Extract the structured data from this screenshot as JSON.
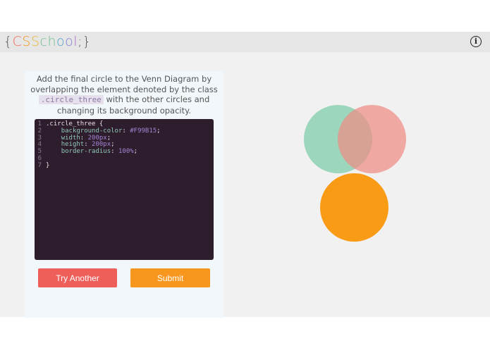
{
  "logo": {
    "parts": [
      {
        "text": "{",
        "color": "#555555"
      },
      {
        "text": "C",
        "color": "#f26b5b"
      },
      {
        "text": "S",
        "color": "#f7971e"
      },
      {
        "text": "S",
        "color": "#e8b838"
      },
      {
        "text": "ch",
        "color": "#6fbf8f"
      },
      {
        "text": "o",
        "color": "#4fa3c9"
      },
      {
        "text": "o",
        "color": "#7f7fd5"
      },
      {
        "text": "l",
        "color": "#a56bd0"
      },
      {
        "text": ";}",
        "color": "#555555"
      }
    ]
  },
  "prompt": {
    "before": "Add the final circle to the Venn Diagram by overlapping the element denoted by the class",
    "code": ".circle_three",
    "after": "with the other circles and changing its background opacity."
  },
  "code": {
    "selector": ".circle_three {",
    "lines": [
      {
        "num": "1"
      },
      {
        "num": "2",
        "prop": "background-color",
        "val": "#F99B15"
      },
      {
        "num": "3",
        "prop": "width",
        "val": "200px"
      },
      {
        "num": "4",
        "prop": "height",
        "val": "200px"
      },
      {
        "num": "5",
        "prop": "border-radius",
        "val": "100%"
      },
      {
        "num": "6"
      },
      {
        "num": "7"
      }
    ],
    "close": "}"
  },
  "buttons": {
    "try": "Try Another",
    "submit": "Submit"
  },
  "colors": {
    "circle_one": "#7fcca9",
    "circle_two": "#ef8c84",
    "circle_three": "#F99B15"
  },
  "icons": {
    "info": "info-icon"
  },
  "info_symbol": "i"
}
